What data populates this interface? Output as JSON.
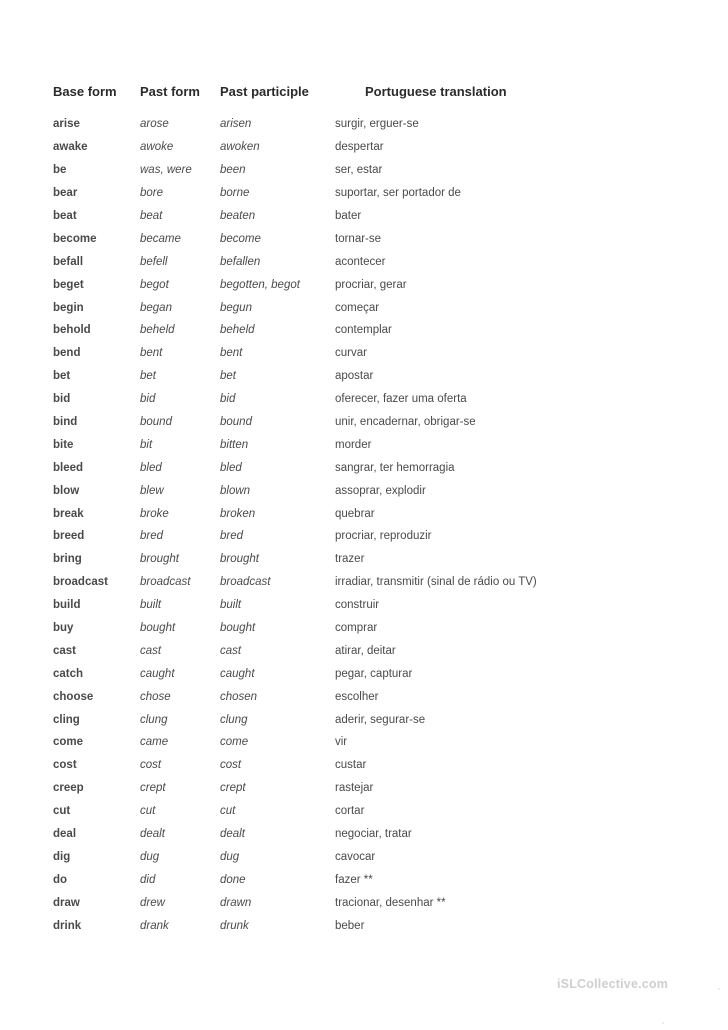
{
  "document": {
    "watermark": "iSLCollective.com"
  },
  "table": {
    "headers": {
      "base": "Base form",
      "past": "Past form",
      "participle": "Past participle",
      "translation": "Portuguese translation"
    },
    "rows": [
      {
        "base": "arise",
        "past": "arose",
        "participle": "arisen",
        "translation": "surgir, erguer-se"
      },
      {
        "base": "awake",
        "past": "awoke",
        "participle": "awoken",
        "translation": "despertar"
      },
      {
        "base": "be",
        "past": "was, were",
        "participle": "been",
        "translation": "ser, estar"
      },
      {
        "base": "bear",
        "past": "bore",
        "participle": "borne",
        "translation": "suportar, ser portador de"
      },
      {
        "base": "beat",
        "past": "beat",
        "participle": "beaten",
        "translation": "bater"
      },
      {
        "base": "become",
        "past": "became",
        "participle": "become",
        "translation": "tornar-se"
      },
      {
        "base": "befall",
        "past": "befell",
        "participle": "befallen",
        "translation": "acontecer"
      },
      {
        "base": "beget",
        "past": "begot",
        "participle": "begotten, begot",
        "translation": "procriar, gerar"
      },
      {
        "base": "begin",
        "past": "began",
        "participle": "begun",
        "translation": "começar"
      },
      {
        "base": "behold",
        "past": "beheld",
        "participle": "beheld",
        "translation": "contemplar"
      },
      {
        "base": "bend",
        "past": "bent",
        "participle": "bent",
        "translation": "curvar"
      },
      {
        "base": "bet",
        "past": "bet",
        "participle": "bet",
        "translation": "apostar"
      },
      {
        "base": "bid",
        "past": "bid",
        "participle": "bid",
        "translation": "oferecer, fazer uma oferta"
      },
      {
        "base": "bind",
        "past": "bound",
        "participle": "bound",
        "translation": "unir, encadernar, obrigar-se"
      },
      {
        "base": "bite",
        "past": "bit",
        "participle": "bitten",
        "translation": "morder"
      },
      {
        "base": "bleed",
        "past": "bled",
        "participle": "bled",
        "translation": "sangrar, ter hemorragia"
      },
      {
        "base": "blow",
        "past": "blew",
        "participle": "blown",
        "translation": "assoprar, explodir"
      },
      {
        "base": "break",
        "past": "broke",
        "participle": "broken",
        "translation": "quebrar"
      },
      {
        "base": "breed",
        "past": "bred",
        "participle": "bred",
        "translation": "procriar, reproduzir"
      },
      {
        "base": "bring",
        "past": "brought",
        "participle": "brought",
        "translation": "trazer"
      },
      {
        "base": "broadcast",
        "past": "broadcast",
        "participle": "broadcast",
        "translation": "irradiar, transmitir (sinal de rádio ou TV)"
      },
      {
        "base": "build",
        "past": "built",
        "participle": "built",
        "translation": "construir"
      },
      {
        "base": "buy",
        "past": "bought",
        "participle": "bought",
        "translation": "comprar"
      },
      {
        "base": "cast",
        "past": "cast",
        "participle": "cast",
        "translation": "atirar, deitar"
      },
      {
        "base": "catch",
        "past": "caught",
        "participle": "caught",
        "translation": "pegar, capturar"
      },
      {
        "base": "choose",
        "past": "chose",
        "participle": "chosen",
        "translation": "escolher"
      },
      {
        "base": "cling",
        "past": "clung",
        "participle": "clung",
        "translation": "aderir, segurar-se"
      },
      {
        "base": "come",
        "past": "came",
        "participle": "come",
        "translation": "vir"
      },
      {
        "base": "cost",
        "past": "cost",
        "participle": "cost",
        "translation": "custar"
      },
      {
        "base": "creep",
        "past": "crept",
        "participle": "crept",
        "translation": "rastejar"
      },
      {
        "base": "cut",
        "past": "cut",
        "participle": "cut",
        "translation": "cortar"
      },
      {
        "base": "deal",
        "past": "dealt",
        "participle": "dealt",
        "translation": "negociar, tratar"
      },
      {
        "base": "dig",
        "past": "dug",
        "participle": "dug",
        "translation": "cavocar"
      },
      {
        "base": "do",
        "past": "did",
        "participle": "done",
        "translation": "fazer **"
      },
      {
        "base": "draw",
        "past": "drew",
        "participle": "drawn",
        "translation": "tracionar, desenhar **"
      },
      {
        "base": "drink",
        "past": "drank",
        "participle": "drunk",
        "translation": "beber"
      }
    ]
  }
}
